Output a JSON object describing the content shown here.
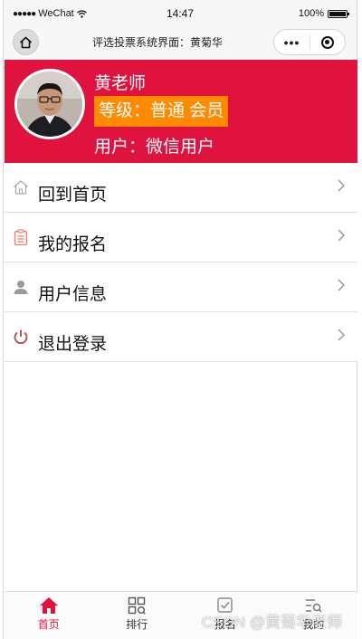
{
  "status_bar": {
    "carrier": "WeChat",
    "time": "14:47",
    "battery": "100%"
  },
  "nav": {
    "title": "评选投票系统界面：黄菊华",
    "more_glyph": "•••"
  },
  "profile": {
    "name": "黄老师",
    "level": "等级：普通 会员",
    "user": "用户：微信用户"
  },
  "menu": [
    {
      "label": "回到首页",
      "icon": "home-outline-icon"
    },
    {
      "label": "我的报名",
      "icon": "clipboard-icon"
    },
    {
      "label": "用户信息",
      "icon": "user-icon"
    },
    {
      "label": "退出登录",
      "icon": "power-icon"
    }
  ],
  "tabbar": {
    "active_color": "#e0123e",
    "tabs": [
      {
        "label": "首页",
        "icon": "home-icon"
      },
      {
        "label": "排行",
        "icon": "grid-icon"
      },
      {
        "label": "报名",
        "icon": "checkbox-icon"
      },
      {
        "label": "我的",
        "icon": "list-search-icon"
      }
    ]
  },
  "watermark": "CSDN @黄菊华老师",
  "colors": {
    "header_bg": "#e0123e",
    "level_badge": "#ff8a00"
  }
}
